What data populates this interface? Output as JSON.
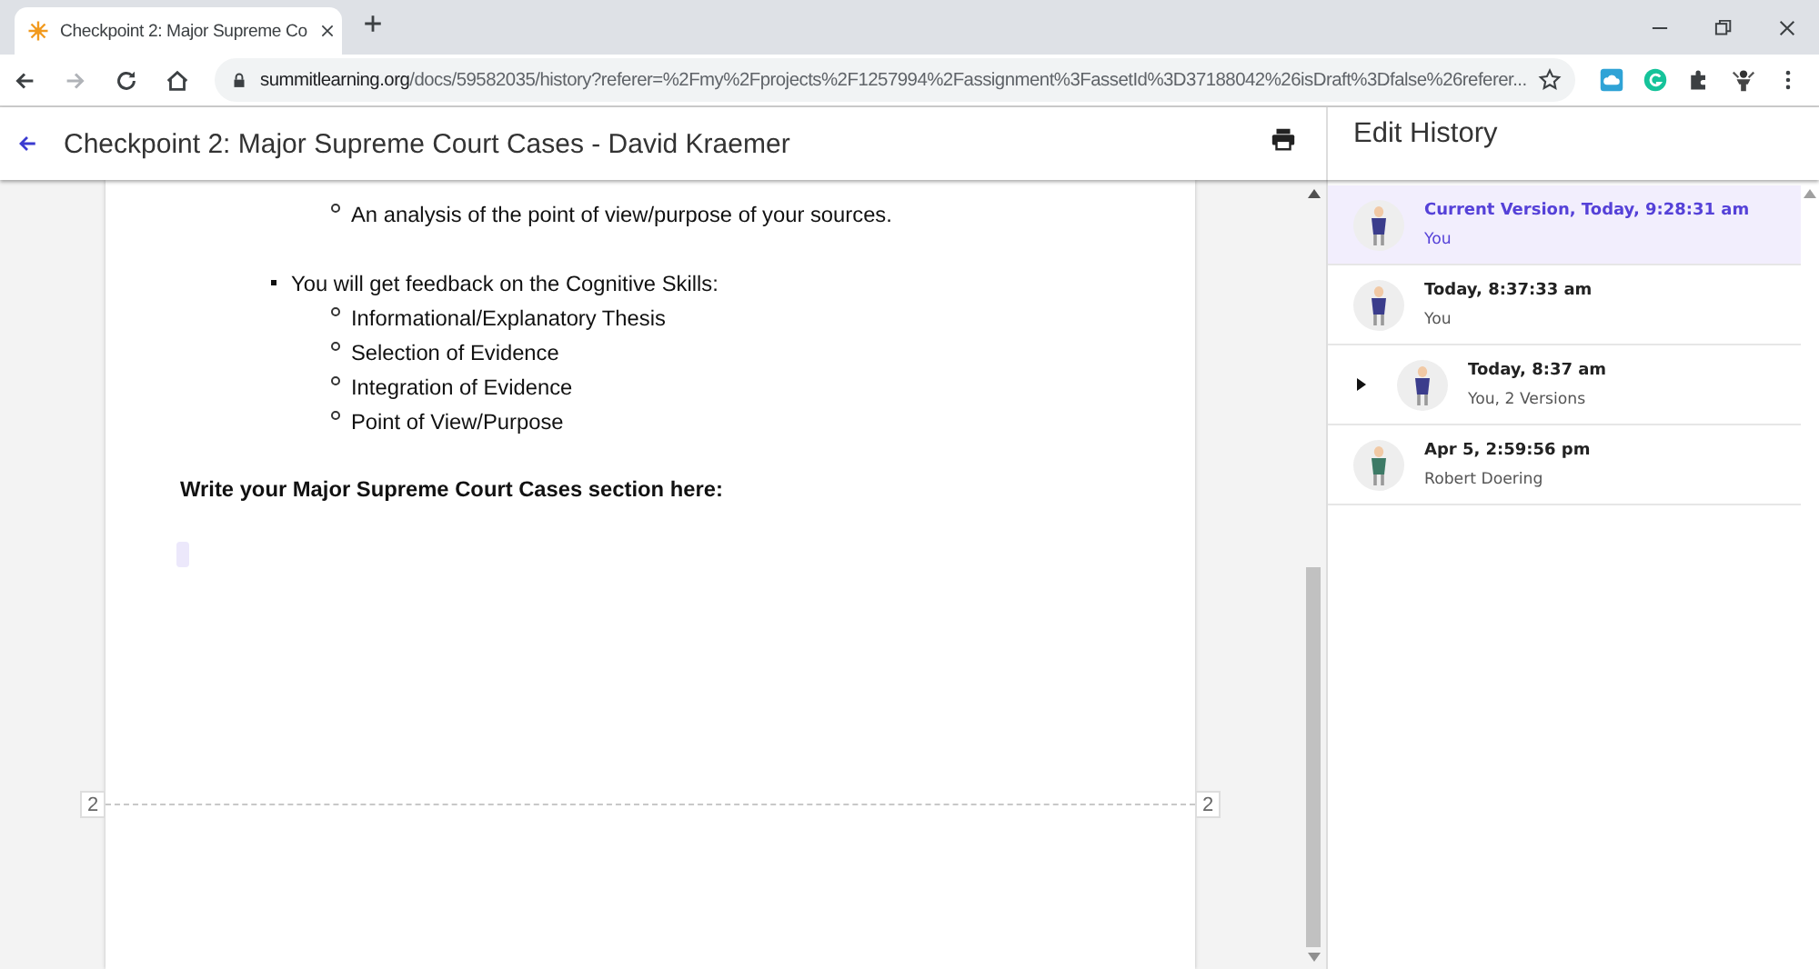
{
  "browser": {
    "tab_title": "Checkpoint 2: Major Supreme Co",
    "url_domain": "summitlearning.org",
    "url_path": "/docs/59582035/history?referer=%2Fmy%2Fprojects%2F1257994%2Fassignment%3FassetId%3D37188042%26isDraft%3Dfalse%26referer..."
  },
  "header": {
    "title": "Checkpoint 2: Major Supreme Court Cases - David Kraemer"
  },
  "document": {
    "blocks": [
      {
        "kind": "sub",
        "text": "An analysis of the point of view/purpose of your sources."
      },
      {
        "kind": "bullet",
        "text": "You will get feedback on the Cognitive Skills:"
      },
      {
        "kind": "sub",
        "text": "Informational/Explanatory Thesis"
      },
      {
        "kind": "sub",
        "text": "Selection of Evidence"
      },
      {
        "kind": "sub",
        "text": "Integration of Evidence"
      },
      {
        "kind": "sub",
        "text": "Point of View/Purpose"
      },
      {
        "kind": "heading",
        "text": "Write your Major Supreme Court Cases section here:"
      }
    ],
    "page_break": {
      "left_label": "2",
      "right_label": "2"
    }
  },
  "history": {
    "title": "Edit History",
    "versions": [
      {
        "kind": "version",
        "time": "Current Version, Today, 9:28:31 am",
        "author": "You",
        "selected": true,
        "color": "#3b3d8c"
      },
      {
        "kind": "version",
        "time": "Today, 8:37:33 am",
        "author": "You",
        "selected": false,
        "color": "#3b3d8c"
      },
      {
        "kind": "group",
        "time": "Today, 8:37 am",
        "author": "You, 2 Versions",
        "selected": false,
        "expanded": false,
        "color": "#3b3d8c"
      },
      {
        "kind": "version",
        "time": "Apr 5, 2:59:56 pm",
        "author": "Robert Doering",
        "selected": false,
        "color": "#3d7a66"
      }
    ]
  }
}
